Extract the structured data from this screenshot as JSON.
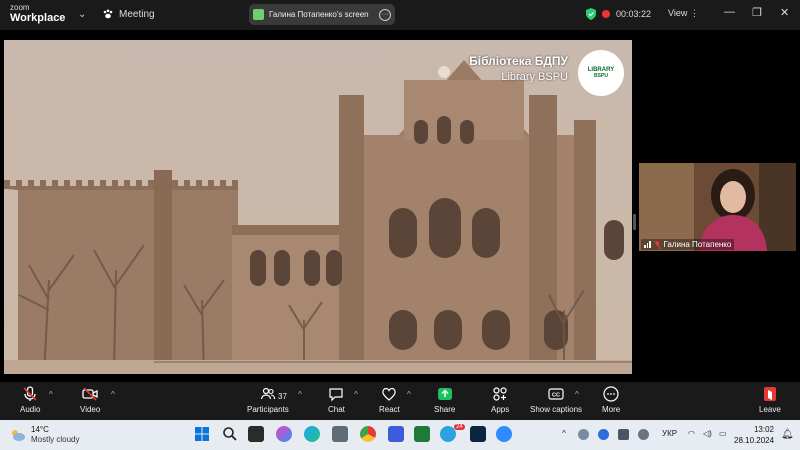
{
  "app": {
    "brand_line1": "zoom",
    "brand_line2": "Workplace",
    "meeting_label": "Meeting",
    "share_label": "Галина Потапенко's screen",
    "timer": "00:03:22",
    "view_label": "View"
  },
  "shared_screen": {
    "title": "Бібліотека БДПУ",
    "subtitle": "Library BSPU",
    "logo_line1": "LIBRARY",
    "logo_line2": "BSPU"
  },
  "participant": {
    "name": "Галина Потапенко"
  },
  "toolbar": {
    "audio": "Audio",
    "video": "Video",
    "participants": "Participants",
    "participants_count": "37",
    "chat": "Chat",
    "react": "React",
    "share": "Share",
    "apps": "Apps",
    "show_captions": "Show captions",
    "more": "More",
    "leave": "Leave"
  },
  "taskbar": {
    "temp": "14°C",
    "weather": "Mostly cloudy",
    "telegram_badge": "24",
    "lang": "УКР",
    "time": "13:02",
    "date": "28.10.2024"
  },
  "colors": {
    "share_green": "#19c05c",
    "leave_red": "#e53935",
    "sepia": "#b89a82"
  }
}
